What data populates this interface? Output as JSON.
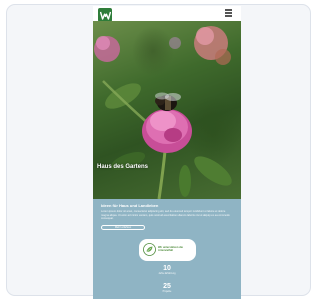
{
  "header": {
    "logo_icon": "w-logo-icon",
    "menu_icon": "hamburger-menu-icon"
  },
  "hero": {
    "caption": "Haus des Gartens",
    "image": "clover-flower-with-bee-photo"
  },
  "info": {
    "title": "Ideen für Haus und Landleben",
    "body": "Lorem ipsum dolor sit amet, consectetur adipiscing elit, sed do eiusmod tempor incididunt ut labore et dolore magna aliqua. Ut enim ad minim veniam, quis nostrud exercitation ullamco laboris nisi ut aliquip ex ea commodo consequat.",
    "button_label": "Mehr erfahren",
    "badge_text": "Wir unterstützen die Artenvielfalt",
    "badge_icon": "leaf-seal-icon"
  },
  "stats": [
    {
      "number": "10",
      "label": "Jahre Erfahrung"
    },
    {
      "number": "25",
      "label": "Projekte"
    }
  ],
  "colors": {
    "accent_green": "#2f7d3a",
    "info_blue": "#8fb4c4"
  }
}
